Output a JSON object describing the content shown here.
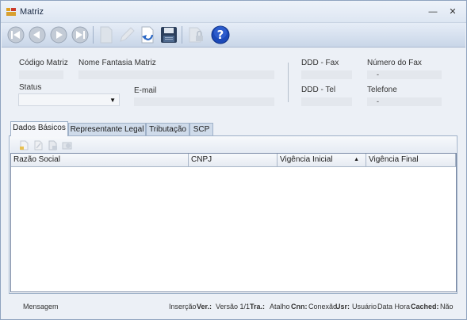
{
  "window": {
    "title": "Matriz",
    "minimize_glyph": "—",
    "close_glyph": "✕"
  },
  "toolbar": {
    "buttons": [
      "first-record-icon",
      "prev-record-icon",
      "next-record-icon",
      "last-record-icon",
      "new-document-icon",
      "edit-pencil-icon",
      "undo-icon",
      "save-floppy-icon",
      "lock-document-icon",
      "help-icon"
    ],
    "help_glyph": "?"
  },
  "form": {
    "codigo_label": "Código Matriz",
    "nome_label": "Nome Fantasia Matriz",
    "status_label": "Status",
    "email_label": "E-mail",
    "ddd_fax_label": "DDD - Fax",
    "numero_fax_label": "Número do Fax",
    "numero_fax_value": "-",
    "ddd_tel_label": "DDD - Tel",
    "telefone_label": "Telefone",
    "telefone_value": "-",
    "status_value": ""
  },
  "tabs": [
    "Dados Básicos",
    "Representante Legal",
    "Tributação",
    "SCP"
  ],
  "grid": {
    "columns": [
      "Razão Social",
      "CNPJ",
      "Vigência Inicial",
      "Vigência Final"
    ],
    "sort_column": "Vigência Inicial",
    "sort_glyph": "▲",
    "rows": []
  },
  "statusbar": {
    "mensagem": "Mensagem",
    "insercao": "Inserção",
    "ver_label": "Ver.:",
    "ver_value": "Versão 1/1",
    "tra_label": "Tra.:",
    "tra_value": "Atalho",
    "cnn_label": "Cnn:",
    "cnn_value": "Conexão",
    "usr_label": "Usr:",
    "usr_value": "Usuário",
    "datahora": "Data Hora",
    "cached_label": "Cached:",
    "cached_value": "Não"
  }
}
